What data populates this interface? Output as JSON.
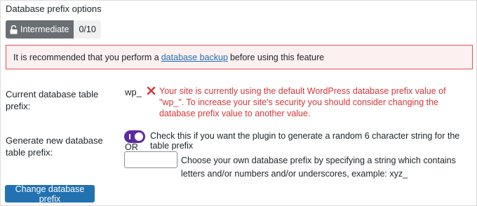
{
  "section": {
    "title": "Database prefix options"
  },
  "badge": {
    "level": "Intermediate",
    "score": "0/10",
    "icon": "lock-open-icon"
  },
  "notice": {
    "before": "It is recommended that you perform a",
    "link": "database backup",
    "after": "before using this feature",
    "color": "#e65054"
  },
  "current_prefix": {
    "label": "Current database table prefix:",
    "value": "wp_",
    "error": "Your site is currently using the default WordPress database prefix value of \"wp_\". To increase your site's security you should consider changing the database prefix value to another value.",
    "error_color": "#d63638"
  },
  "generate_prefix": {
    "label": "Generate new database table prefix:",
    "toggle_on": true,
    "toggle_desc": "Check this if you want the plugin to generate a random 6 character string for the table prefix",
    "or": "OR",
    "input_value": "",
    "input_desc": "Choose your own database prefix by specifying a string which contains letters and/or numbers and/or underscores, example: xyz_"
  },
  "submit": {
    "label": "Change database prefix",
    "color": "#2271b1"
  }
}
